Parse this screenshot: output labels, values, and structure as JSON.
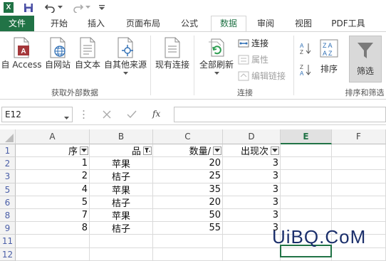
{
  "title_bar": {
    "app_logo": "X",
    "icons": [
      "excel-logo-icon",
      "save-icon",
      "undo-icon",
      "redo-icon"
    ]
  },
  "tabs": [
    {
      "label": "文件",
      "active": false,
      "file": true
    },
    {
      "label": "开始",
      "active": false
    },
    {
      "label": "插入",
      "active": false
    },
    {
      "label": "页面布局",
      "active": false
    },
    {
      "label": "公式",
      "active": false
    },
    {
      "label": "数据",
      "active": true
    },
    {
      "label": "审阅",
      "active": false
    },
    {
      "label": "视图",
      "active": false
    },
    {
      "label": "PDF工具",
      "active": false
    }
  ],
  "ribbon": {
    "external": {
      "from_access": "自 Access",
      "from_web": "自网站",
      "from_text": "自文本",
      "from_other": "自其他来源",
      "group_label": "获取外部数据"
    },
    "existing_connections": "现有连接",
    "connections": {
      "refresh_all": "全部刷新",
      "connections": "连接",
      "properties": "属性",
      "edit_links": "编辑链接",
      "group_label": "连接"
    },
    "sort_filter": {
      "sort": "排序",
      "filter": "筛选",
      "group_label": "排序和筛选"
    }
  },
  "formula_bar": {
    "name_box": "E12",
    "fx": "fx",
    "formula": ""
  },
  "sheet": {
    "columns": [
      "A",
      "B",
      "C",
      "D",
      "E",
      "F"
    ],
    "selected_column": "E",
    "rows": [
      {
        "num": "1",
        "cells": [
          "序",
          "品",
          "数量/",
          "出现次",
          ""
        ],
        "header": true
      },
      {
        "num": "2",
        "cells": [
          "1",
          "苹果",
          "20",
          "3",
          ""
        ]
      },
      {
        "num": "3",
        "cells": [
          "2",
          "桔子",
          "25",
          "3",
          ""
        ]
      },
      {
        "num": "5",
        "cells": [
          "4",
          "苹果",
          "35",
          "3",
          ""
        ]
      },
      {
        "num": "6",
        "cells": [
          "5",
          "桔子",
          "20",
          "3",
          ""
        ]
      },
      {
        "num": "8",
        "cells": [
          "7",
          "苹果",
          "50",
          "3",
          ""
        ]
      },
      {
        "num": "9",
        "cells": [
          "8",
          "桔子",
          "55",
          "3",
          ""
        ]
      },
      {
        "num": "11",
        "cells": [
          "",
          "",
          "",
          "",
          ""
        ]
      },
      {
        "num": "12",
        "cells": [
          "",
          "",
          "",
          "",
          ""
        ]
      }
    ]
  },
  "watermark": "UiBQ.CoM",
  "colors": {
    "accent": "#217346",
    "row_header_text": "#4b5fa8"
  }
}
